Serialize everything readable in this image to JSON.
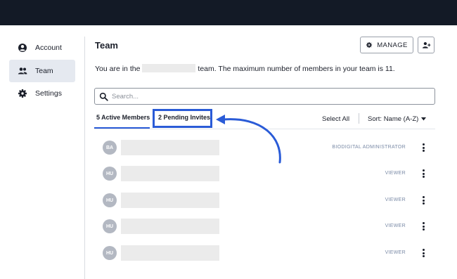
{
  "sidebar": {
    "items": [
      {
        "label": "Account",
        "icon": "user-circle-icon"
      },
      {
        "label": "Team",
        "icon": "users-icon",
        "active": true
      },
      {
        "label": "Settings",
        "icon": "gear-icon"
      }
    ]
  },
  "header": {
    "title": "Team",
    "manage_label": "MANAGE",
    "team_line_prefix": "You are in the",
    "team_line_suffix": "team. The maximum number of members in your team is 11."
  },
  "search": {
    "placeholder": "Search..."
  },
  "tabs": {
    "active_members": "5 Active Members",
    "pending_invites": "2 Pending Invites"
  },
  "toolbar": {
    "select_all": "Select All",
    "sort_label": "Sort: Name (A-Z)"
  },
  "members": [
    {
      "initials": "BA",
      "role": "BIODIGITAL ADMINISTRATOR"
    },
    {
      "initials": "HU",
      "role": "VIEWER"
    },
    {
      "initials": "HU",
      "role": "VIEWER"
    },
    {
      "initials": "HU",
      "role": "VIEWER"
    },
    {
      "initials": "HU",
      "role": "VIEWER"
    }
  ],
  "colors": {
    "topbar": "#131a26",
    "accent": "#2a5bd7",
    "active_nav_bg": "#e5e9f0",
    "role_text": "#7a8aa6"
  }
}
